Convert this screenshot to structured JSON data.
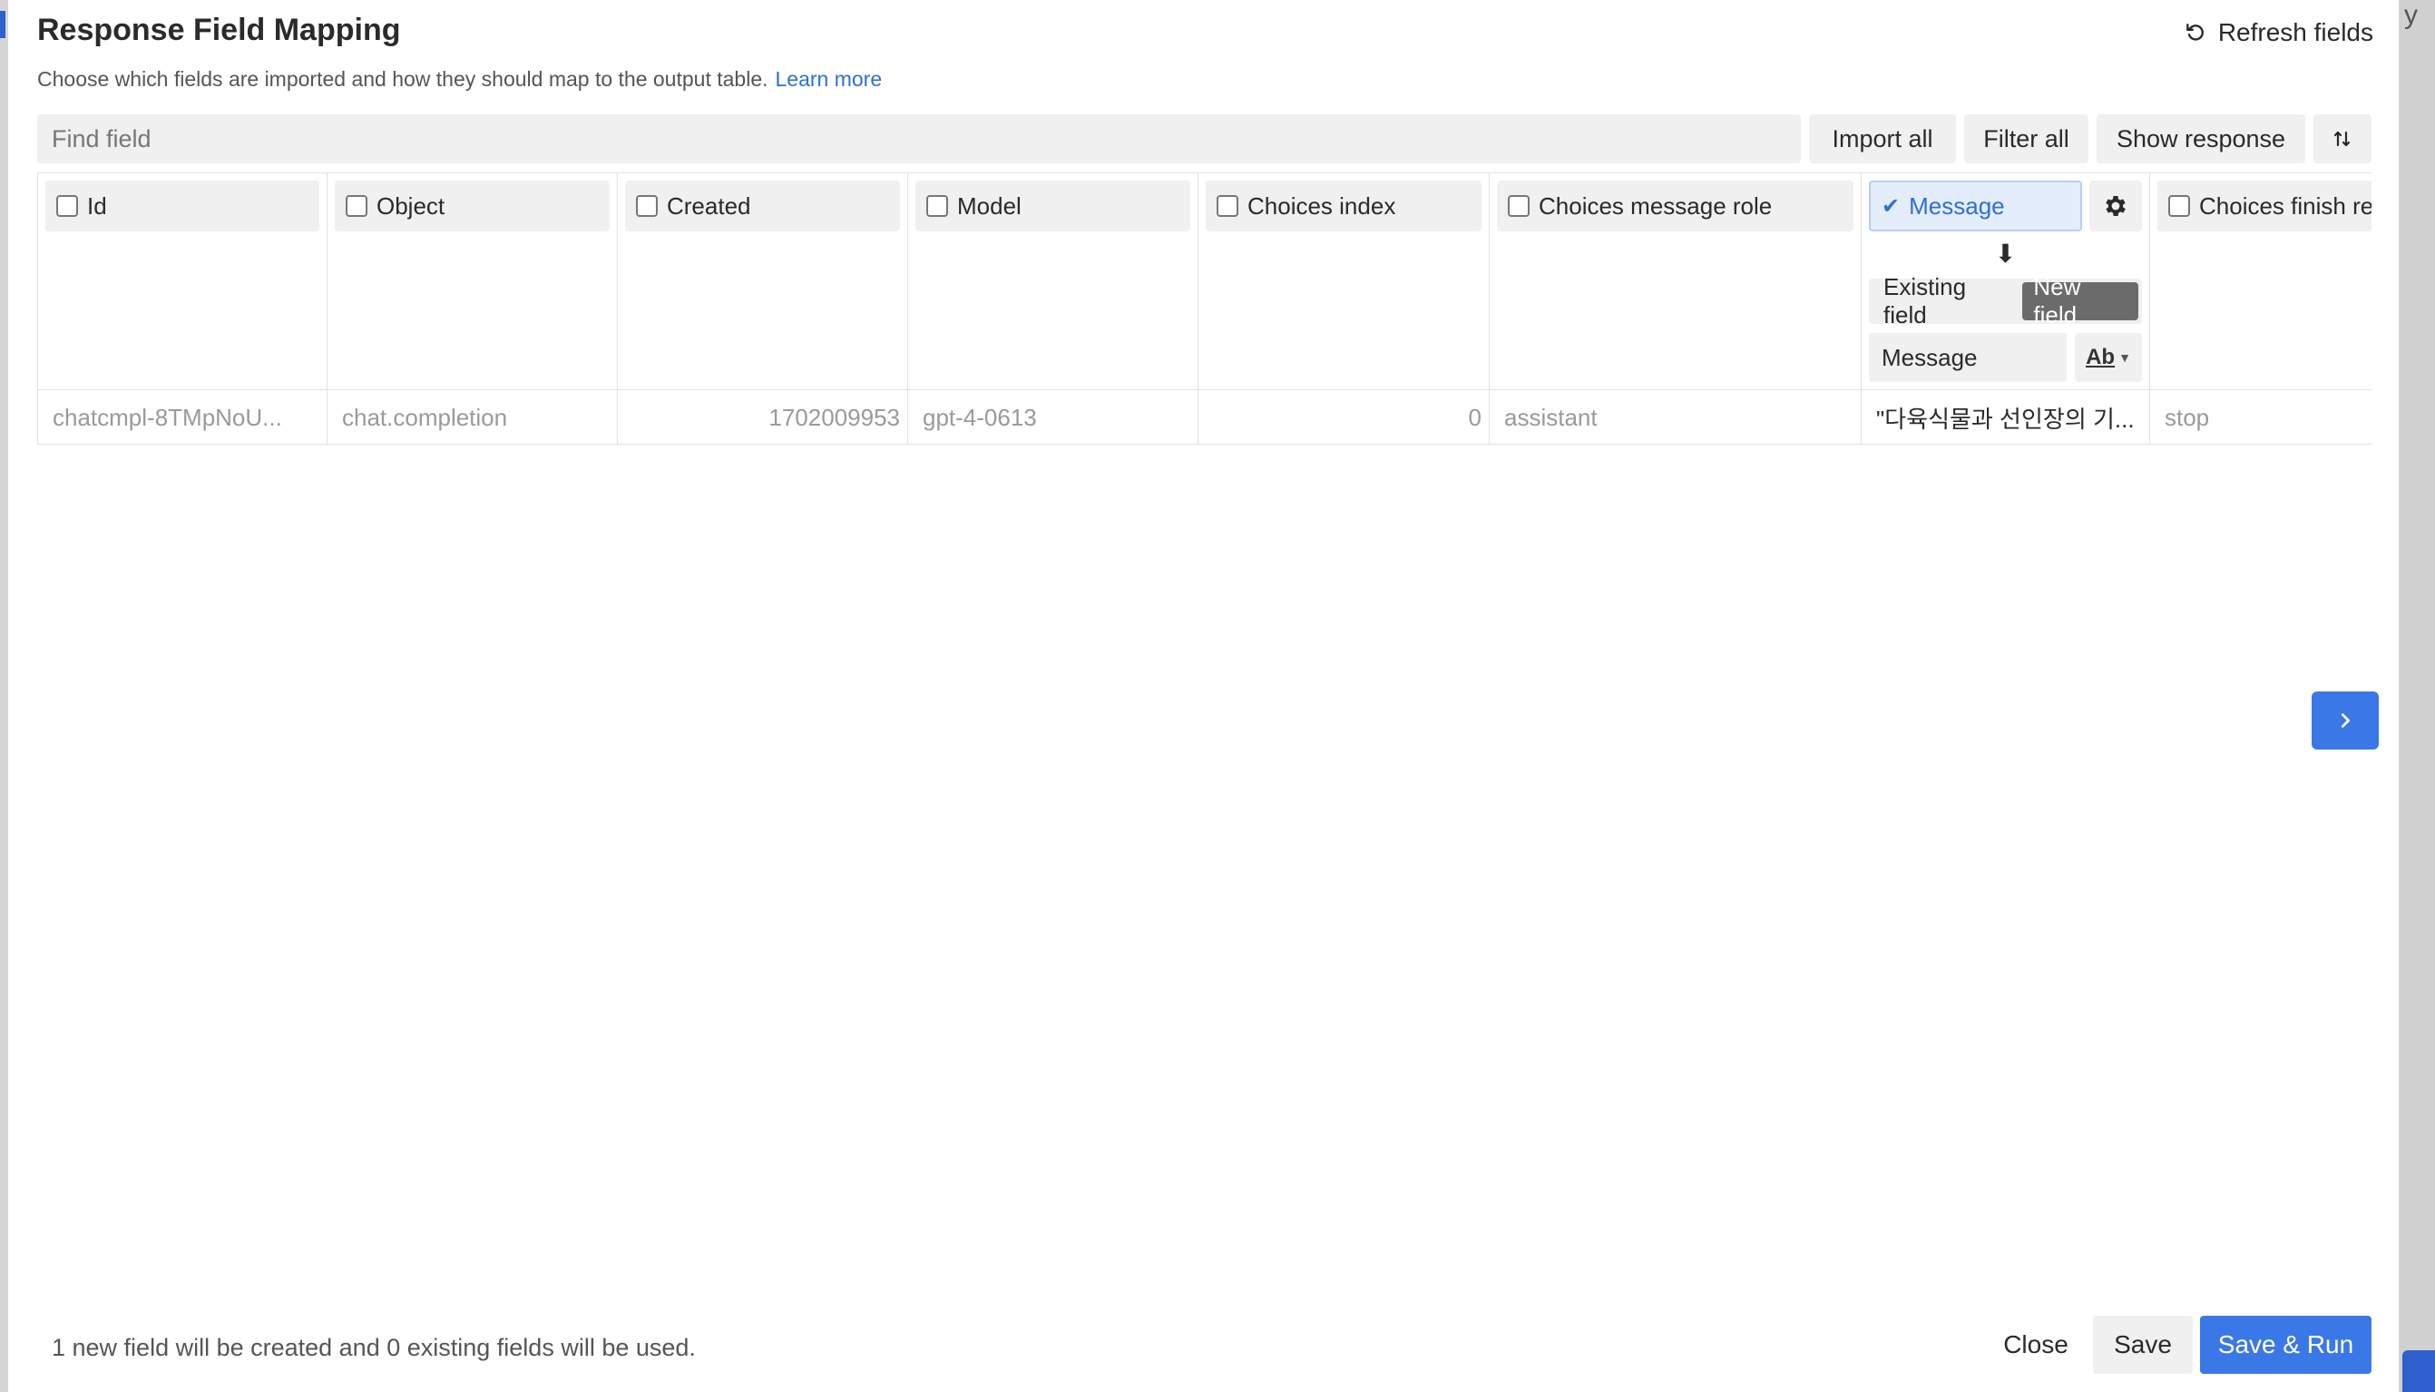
{
  "background": {
    "right_text": "y"
  },
  "header": {
    "title": "Response Field Mapping",
    "refresh_label": "Refresh fields",
    "subtitle": "Choose which fields are imported and how they should map to the output table.",
    "learn_more": "Learn more"
  },
  "toolbar": {
    "search_placeholder": "Find field",
    "import_all": "Import all",
    "filter_all": "Filter all",
    "show_response": "Show response"
  },
  "columns": [
    {
      "label": "Id",
      "value": "chatcmpl-8TMpNoU...",
      "checked": false
    },
    {
      "label": "Object",
      "value": "chat.completion",
      "checked": false
    },
    {
      "label": "Created",
      "value": "1702009953",
      "checked": false
    },
    {
      "label": "Model",
      "value": "gpt-4-0613",
      "checked": false
    },
    {
      "label": "Choices index",
      "value": "0",
      "checked": false
    },
    {
      "label": "Choices message role",
      "value": "assistant",
      "checked": false
    },
    {
      "label": "Message",
      "value": "\"다육식물과 선인장의 기...",
      "checked": true
    },
    {
      "label": "Choices finish re",
      "value": "stop",
      "checked": false
    }
  ],
  "mapping": {
    "existing_field": "Existing field",
    "new_field": "New field",
    "field_name": "Message",
    "type_icon": "text-type-icon",
    "mode": "new"
  },
  "footer": {
    "summary": "1 new field will be created and 0 existing fields will be used.",
    "close": "Close",
    "save": "Save",
    "save_run": "Save & Run"
  },
  "colors": {
    "accent": "#3b78e7",
    "link": "#2f6fd6",
    "selected_bg": "#e4edfb"
  }
}
